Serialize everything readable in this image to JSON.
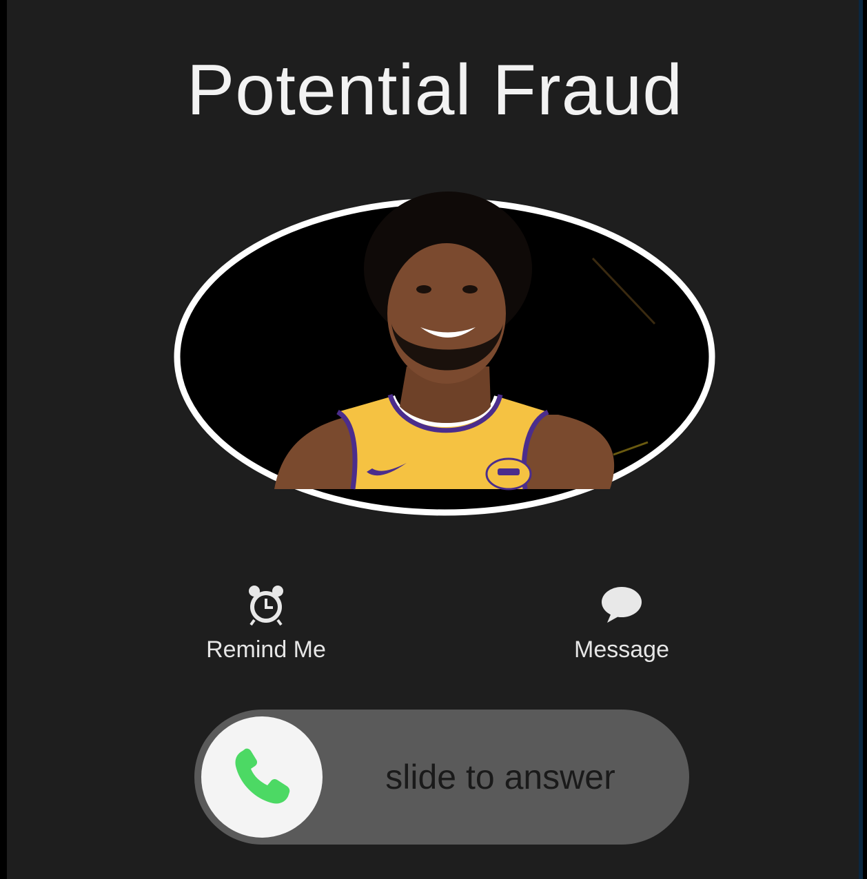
{
  "call": {
    "caller_name": "Potential Fraud"
  },
  "actions": [
    {
      "label": "Remind Me",
      "icon": "alarm-clock-icon"
    },
    {
      "label": "Message",
      "icon": "speech-bubble-icon"
    }
  ],
  "answer_slider": {
    "label": "slide to answer",
    "icon": "phone-icon",
    "accent_color": "#4cd964"
  },
  "colors": {
    "background": "#1e1e1e",
    "text": "#f2f2f2",
    "slider_track": "#5a5a5a"
  }
}
